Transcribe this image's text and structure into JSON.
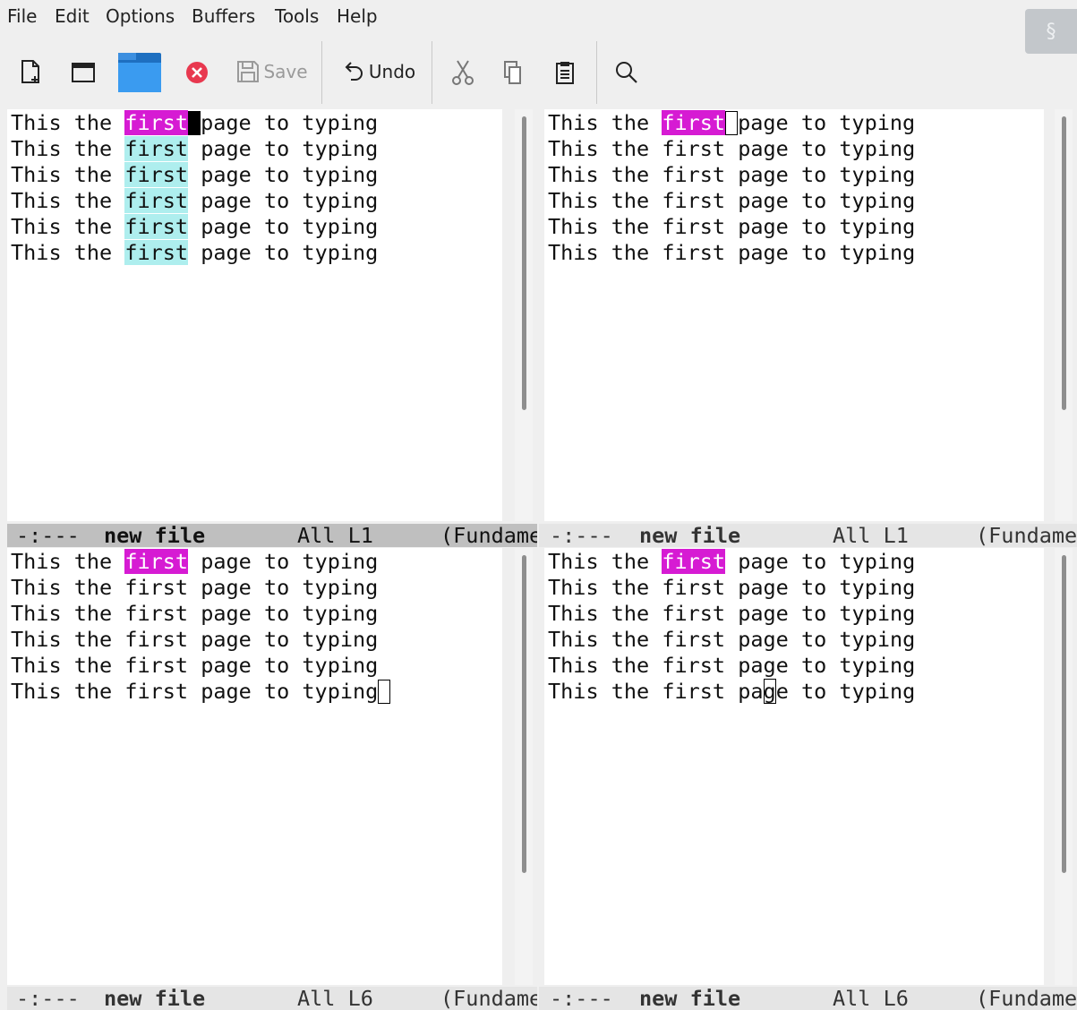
{
  "menubar": {
    "items": [
      "File",
      "Edit",
      "Options",
      "Buffers",
      "Tools",
      "Help"
    ],
    "hidden_menu_glyph": "§"
  },
  "toolbar": {
    "save_label": "Save",
    "undo_label": "Undo",
    "icons": [
      "new-file-icon",
      "open-directory-icon",
      "folder-icon",
      "close-icon",
      "save-icon",
      "undo-icon",
      "cut-icon",
      "copy-icon",
      "paste-icon",
      "search-icon"
    ]
  },
  "colors": {
    "isearch_match": "#d61bd3",
    "lazy_highlight": "#aeeeee",
    "modeline_active": "#bfbfbf",
    "modeline_inactive": "#e5e5e5"
  },
  "windows": [
    {
      "lines": [
        {
          "pre": "This the ",
          "match": "first",
          "post": "page to typing",
          "match_style": "purple",
          "cursor": "block"
        },
        {
          "pre": "This the ",
          "match": "first",
          "post": " page to typing",
          "match_style": "cyan"
        },
        {
          "pre": "This the ",
          "match": "first",
          "post": " page to typing",
          "match_style": "cyan"
        },
        {
          "pre": "This the ",
          "match": "first",
          "post": " page to typing",
          "match_style": "cyan"
        },
        {
          "pre": "This the ",
          "match": "first",
          "post": " page to typing",
          "match_style": "cyan"
        },
        {
          "pre": "This the ",
          "match": "first",
          "post": " page to typing",
          "match_style": "cyan"
        }
      ],
      "modeline": {
        "status": "-:---",
        "buffer": "new file",
        "position": "All L1",
        "mode": "(Fundame"
      }
    },
    {
      "lines": [
        {
          "pre": "This the ",
          "match": "first",
          "post": "page to typing",
          "match_style": "purple",
          "cursor": "hollow"
        },
        {
          "pre": "This the first page to typing"
        },
        {
          "pre": "This the first page to typing"
        },
        {
          "pre": "This the first page to typing"
        },
        {
          "pre": "This the first page to typing"
        },
        {
          "pre": "This the first page to typing"
        }
      ],
      "modeline": {
        "status": "-:---",
        "buffer": "new file",
        "position": "All L1",
        "mode": "(Fundame"
      }
    },
    {
      "lines": [
        {
          "pre": "This the ",
          "match": "first",
          "post": " page to typing",
          "match_style": "purple"
        },
        {
          "pre": "This the first page to typing"
        },
        {
          "pre": "This the first page to typing"
        },
        {
          "pre": "This the first page to typing"
        },
        {
          "pre": "This the first page to typing"
        },
        {
          "pre": "This the first page to typing",
          "cursor": "hollow-end"
        }
      ],
      "modeline": {
        "status": "-:---",
        "buffer": "new file",
        "position": "All L6",
        "mode": "(Fundame"
      }
    },
    {
      "lines": [
        {
          "pre": "This the ",
          "match": "first",
          "post": " page to typing",
          "match_style": "purple"
        },
        {
          "pre": "This the first page to typing"
        },
        {
          "pre": "This the first page to typing"
        },
        {
          "pre": "This the first page to typing"
        },
        {
          "pre": "This the first page to typing"
        },
        {
          "pre": "This the first pa",
          "cursor_char": "g",
          "post": "e to typing",
          "cursor": "over"
        }
      ],
      "modeline": {
        "status": "-:---",
        "buffer": "new file",
        "position": "All L6",
        "mode": "(Fundame"
      }
    }
  ]
}
